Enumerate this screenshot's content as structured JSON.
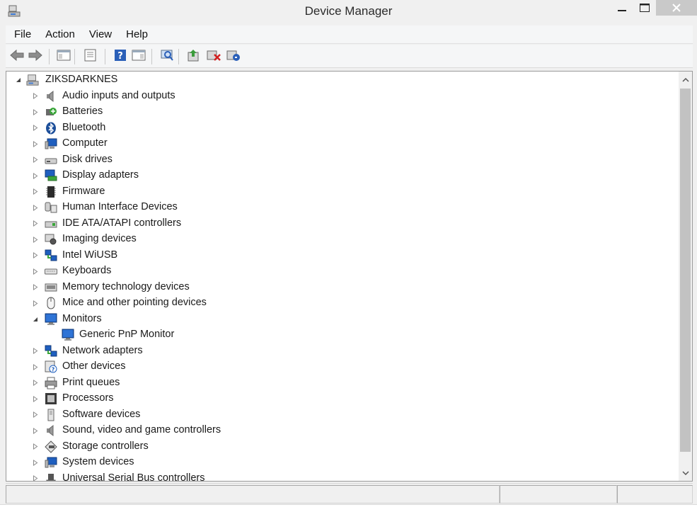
{
  "window": {
    "title": "Device Manager"
  },
  "menu": [
    {
      "label": "File"
    },
    {
      "label": "Action"
    },
    {
      "label": "View"
    },
    {
      "label": "Help"
    }
  ],
  "toolbar": [
    {
      "icon": "back-arrow-icon"
    },
    {
      "icon": "forward-arrow-icon"
    },
    {
      "icon": "show-hide-console-tree-icon"
    },
    {
      "icon": "properties-icon"
    },
    {
      "icon": "help-icon"
    },
    {
      "icon": "show-action-pane-icon"
    },
    {
      "icon": "scan-hardware-changes-icon"
    },
    {
      "icon": "update-driver-icon"
    },
    {
      "icon": "uninstall-device-icon"
    },
    {
      "icon": "enable-device-icon"
    }
  ],
  "tree": {
    "root": "ZIKSDARKNES",
    "items": [
      {
        "label": "Audio inputs and outputs",
        "icon": "speaker-icon",
        "expanded": false
      },
      {
        "label": "Batteries",
        "icon": "battery-icon",
        "expanded": false
      },
      {
        "label": "Bluetooth",
        "icon": "bluetooth-icon",
        "expanded": false
      },
      {
        "label": "Computer",
        "icon": "computer-icon",
        "expanded": false
      },
      {
        "label": "Disk drives",
        "icon": "disk-drive-icon",
        "expanded": false
      },
      {
        "label": "Display adapters",
        "icon": "display-adapter-icon",
        "expanded": false
      },
      {
        "label": "Firmware",
        "icon": "firmware-icon",
        "expanded": false
      },
      {
        "label": "Human Interface Devices",
        "icon": "hid-icon",
        "expanded": false
      },
      {
        "label": "IDE ATA/ATAPI controllers",
        "icon": "ide-controller-icon",
        "expanded": false
      },
      {
        "label": "Imaging devices",
        "icon": "camera-icon",
        "expanded": false
      },
      {
        "label": "Intel WiUSB",
        "icon": "network-icon",
        "expanded": false
      },
      {
        "label": "Keyboards",
        "icon": "keyboard-icon",
        "expanded": false
      },
      {
        "label": "Memory technology devices",
        "icon": "memory-icon",
        "expanded": false
      },
      {
        "label": "Mice and other pointing devices",
        "icon": "mouse-icon",
        "expanded": false
      },
      {
        "label": "Monitors",
        "icon": "monitor-icon",
        "expanded": true
      },
      {
        "label": "Generic PnP Monitor",
        "icon": "monitor-icon",
        "child": true
      },
      {
        "label": "Network adapters",
        "icon": "network-icon",
        "expanded": false
      },
      {
        "label": "Other devices",
        "icon": "unknown-device-icon",
        "expanded": false
      },
      {
        "label": "Print queues",
        "icon": "printer-icon",
        "expanded": false
      },
      {
        "label": "Processors",
        "icon": "processor-icon",
        "expanded": false
      },
      {
        "label": "Software devices",
        "icon": "software-device-icon",
        "expanded": false
      },
      {
        "label": "Sound, video and game controllers",
        "icon": "speaker-icon",
        "expanded": false
      },
      {
        "label": "Storage controllers",
        "icon": "storage-controller-icon",
        "expanded": false
      },
      {
        "label": "System devices",
        "icon": "computer-icon",
        "expanded": false
      },
      {
        "label": "Universal Serial Bus controllers",
        "icon": "usb-icon",
        "expanded": false
      }
    ]
  },
  "colors": {
    "accent": "#1f5fbf",
    "close_button": "#c9c9c9"
  }
}
